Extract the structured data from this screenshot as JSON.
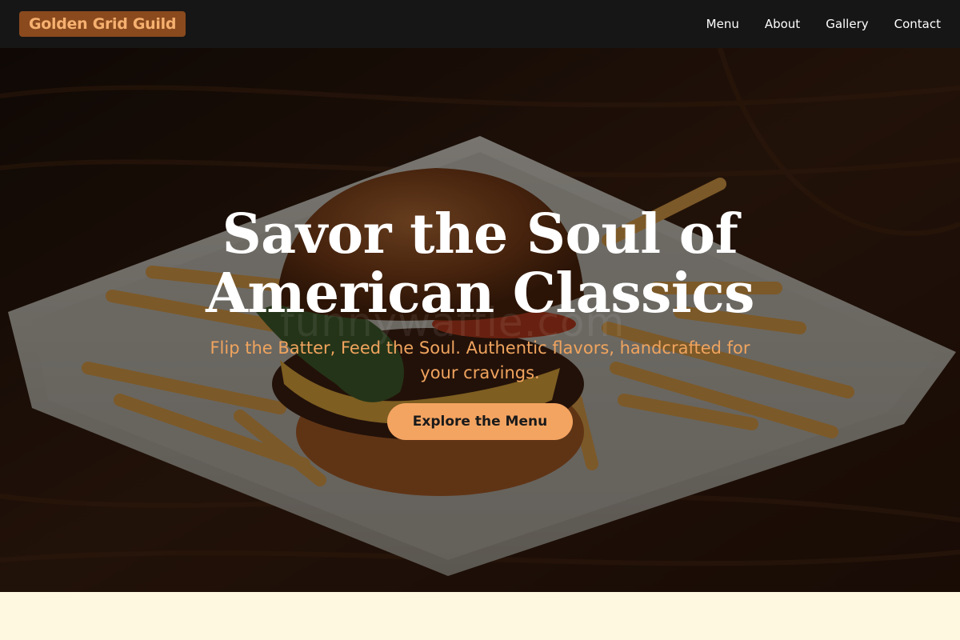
{
  "nav": {
    "brand": "Golden Grid Guild",
    "links": [
      "Menu",
      "About",
      "Gallery",
      "Contact"
    ]
  },
  "hero": {
    "title": "Savor the Soul of American Classics",
    "subtitle": "Flip the Batter, Feed the Soul. Authentic flavors, handcrafted for your cravings.",
    "cta_label": "Explore the Menu",
    "watermark": "funnywaffle.com"
  },
  "colors": {
    "navbar_bg": "#161616",
    "brand_bg": "#8a4a1d",
    "brand_text": "#f6b070",
    "accent": "#f4a461",
    "subtitle": "#f0a45e",
    "section_bg": "#fff8e1"
  },
  "icons": {
    "hero_image": "burger-and-fries-photo"
  }
}
